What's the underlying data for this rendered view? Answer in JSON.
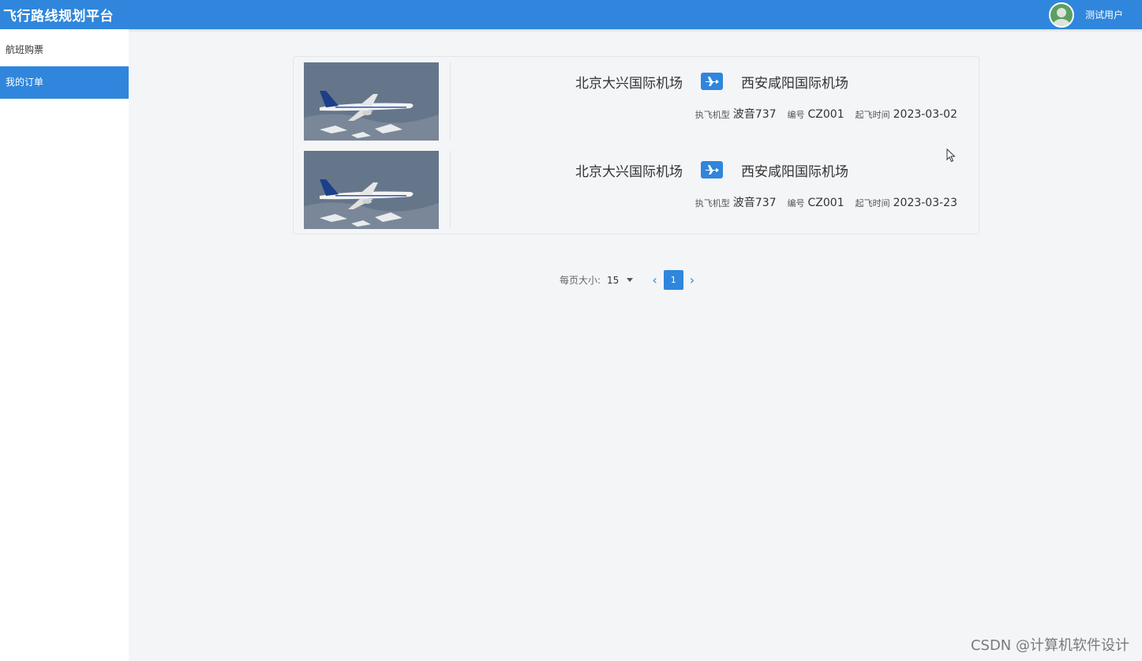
{
  "header": {
    "app_title": "飞行路线规划平台",
    "user_name": "测试用户"
  },
  "sidebar": {
    "items": [
      {
        "label": "航班购票",
        "active": false
      },
      {
        "label": "我的订单",
        "active": true
      }
    ]
  },
  "orders": [
    {
      "from": "北京大兴国际机场",
      "to": "西安咸阳国际机场",
      "aircraft_label": "执飞机型",
      "aircraft": "波音737",
      "number_label": "编号",
      "number": "CZ001",
      "departure_label": "起飞时间",
      "departure": "2023-03-02"
    },
    {
      "from": "北京大兴国际机场",
      "to": "西安咸阳国际机场",
      "aircraft_label": "执飞机型",
      "aircraft": "波音737",
      "number_label": "编号",
      "number": "CZ001",
      "departure_label": "起飞时间",
      "departure": "2023-03-23"
    }
  ],
  "pagination": {
    "size_label": "每页大小:",
    "page_size": "15",
    "current_page": "1"
  },
  "watermark": "CSDN @计算机软件设计",
  "colors": {
    "primary": "#2f86dc",
    "background": "#f4f5f7",
    "sidebar_bg": "#ffffff"
  }
}
